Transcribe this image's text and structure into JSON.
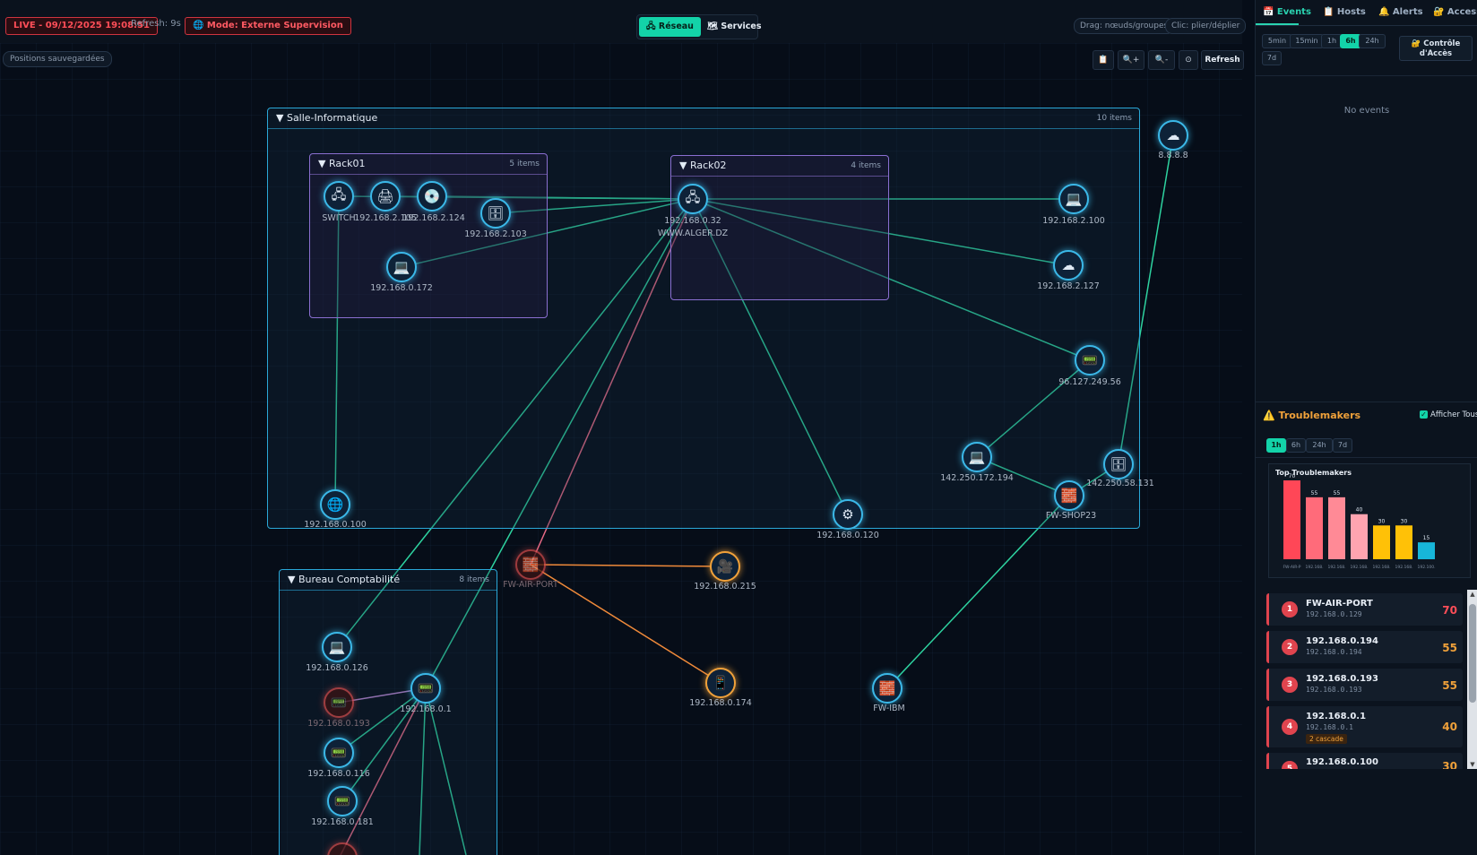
{
  "header": {
    "live_label": "LIVE - 09/12/2025 19:08:51",
    "refresh_label": "Refresh: 9s",
    "mode_label": "🌐 Mode: Externe Supervision",
    "view_tabs": [
      {
        "label": "🖧 Réseau",
        "active": true
      },
      {
        "label": "🗺 Services",
        "active": false
      }
    ],
    "hint_drag": "Drag: nœuds/groupes",
    "hint_click": "Clic: plier/déplier"
  },
  "canvas": {
    "saved_label": "Positions sauvegardées",
    "toolbar": {
      "clipboard": "📋",
      "zoom_in": "🔍+",
      "zoom_out": "🔍-",
      "reset": "⊙",
      "refresh": "Refresh"
    },
    "groups": {
      "salle": {
        "title": "▼ Salle-Informatique",
        "count": "10 items"
      },
      "rack01": {
        "title": "▼ Rack01",
        "count": "5 items"
      },
      "rack02": {
        "title": "▼ Rack02",
        "count": "4 items"
      },
      "bureau": {
        "title": "▼ Bureau Comptabilité",
        "count": "8 items"
      }
    },
    "nodes": {
      "switch": {
        "label": "SWITCH",
        "icon": "switch-icon"
      },
      "n2_105": {
        "label": "192.168.2.105",
        "icon": "printer-icon"
      },
      "n2_124": {
        "label": "192.168.2.124",
        "icon": "disk-icon"
      },
      "n2_103": {
        "label": "192.168.2.103",
        "icon": "server-icon"
      },
      "n0_172": {
        "label": "192.168.0.172",
        "icon": "laptop-icon"
      },
      "alger": {
        "label": "192.168.0.32",
        "label2": "WWW.ALGER.DZ",
        "icon": "switch-icon"
      },
      "n2_100": {
        "label": "192.168.2.100",
        "icon": "laptop-icon"
      },
      "n2_127": {
        "label": "192.168.2.127",
        "icon": "cloud-icon"
      },
      "dns": {
        "label": "8.8.8.8",
        "icon": "cloud-icon"
      },
      "n96": {
        "label": "96.127.249.56",
        "icon": "router-icon"
      },
      "n142_194": {
        "label": "142.250.172.194",
        "icon": "laptop-icon"
      },
      "n142_131": {
        "label": "142.250.58.131",
        "icon": "server-icon"
      },
      "fwshop": {
        "label": "FW-SHOP23",
        "icon": "firewall-icon"
      },
      "n0_100": {
        "label": "192.168.0.100",
        "icon": "globe-icon"
      },
      "n0_120": {
        "label": "192.168.0.120",
        "icon": "gear-icon"
      },
      "fwair": {
        "label": "FW-AIR-PORT",
        "icon": "firewall-icon"
      },
      "n0_215": {
        "label": "192.168.0.215",
        "icon": "camera-icon"
      },
      "n0_174": {
        "label": "192.168.0.174",
        "icon": "phone-icon"
      },
      "fwibm": {
        "label": "FW-IBM",
        "icon": "firewall-icon"
      },
      "n0_126": {
        "label": "192.168.0.126",
        "icon": "laptop-icon"
      },
      "n0_193": {
        "label": "192.168.0.193",
        "icon": "router-icon"
      },
      "n0_1": {
        "label": "192.168.0.1",
        "icon": "router-icon"
      },
      "n0_116": {
        "label": "192.168.0.116",
        "icon": "router-icon"
      },
      "n0_181": {
        "label": "192.168.0.181",
        "icon": "router-icon"
      }
    }
  },
  "panel": {
    "tabs": [
      {
        "label": "📅 Events",
        "active": true
      },
      {
        "label": "📋 Hosts",
        "active": false
      },
      {
        "label": "🔔 Alerts",
        "active": false
      },
      {
        "label": "🔐 Access",
        "active": false
      }
    ],
    "event_ranges": [
      {
        "label": "5min",
        "active": false
      },
      {
        "label": "15min",
        "active": false
      },
      {
        "label": "1h",
        "active": false
      },
      {
        "label": "6h",
        "active": true
      },
      {
        "label": "24h",
        "active": false
      },
      {
        "label": "7d",
        "active": false
      }
    ],
    "access_control_line1": "🔐 Contrôle",
    "access_control_line2": "d'Accès",
    "no_events": "No events",
    "troublemakers_title": "⚠️ Troublemakers",
    "show_all_label": "Afficher Tous",
    "tm_ranges": [
      {
        "label": "1h",
        "active": true
      },
      {
        "label": "6h",
        "active": false
      },
      {
        "label": "24h",
        "active": false
      },
      {
        "label": "7d",
        "active": false
      }
    ],
    "list": [
      {
        "rank": "1",
        "name": "FW-AIR-PORT",
        "sub": "192.168.0.129",
        "score": "70"
      },
      {
        "rank": "2",
        "name": "192.168.0.194",
        "sub": "192.168.0.194",
        "score": "55"
      },
      {
        "rank": "3",
        "name": "192.168.0.193",
        "sub": "192.168.0.193",
        "score": "55"
      },
      {
        "rank": "4",
        "name": "192.168.0.1",
        "sub": "192.168.0.1",
        "score": "40",
        "badge": "2 cascade"
      },
      {
        "rank": "5",
        "name": "192.168.0.100",
        "sub": "",
        "score": "30"
      }
    ]
  },
  "chart_data": {
    "type": "bar",
    "title": "Top Troublemakers",
    "categories": [
      "FW-AIR-P",
      "192.168.",
      "192.168.",
      "192.168.",
      "192.168.",
      "192.168.",
      "192.100."
    ],
    "values": [
      70,
      55,
      55,
      40,
      30,
      30,
      15
    ],
    "ylim": [
      0,
      70
    ],
    "colors": [
      "#ff4757",
      "#ff6b7a",
      "#ff8a96",
      "#ffa4b0",
      "#ffc107",
      "#ffc107",
      "#17b6d9"
    ]
  }
}
